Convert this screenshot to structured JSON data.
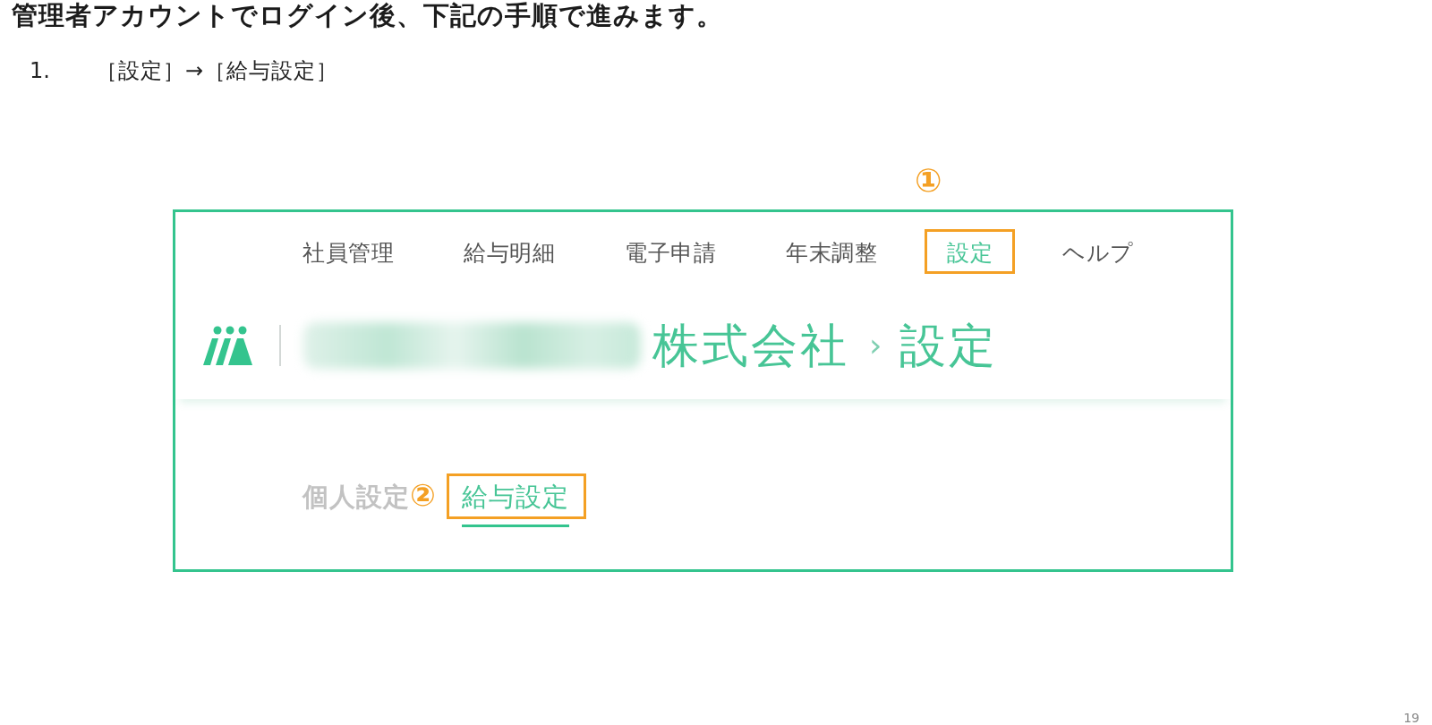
{
  "heading": "管理者アカウントでログイン後、下記の手順で進みます。",
  "steps": [
    {
      "number": "1.",
      "text": "［設定］→［給与設定］"
    }
  ],
  "screenshot": {
    "nav": [
      {
        "label": "社員管理",
        "selected": false,
        "highlighted": false
      },
      {
        "label": "給与明細",
        "selected": false,
        "highlighted": false
      },
      {
        "label": "電子申請",
        "selected": false,
        "highlighted": false
      },
      {
        "label": "年末調整",
        "selected": false,
        "highlighted": false
      },
      {
        "label": "設定",
        "selected": true,
        "highlighted": true,
        "callout": "①"
      },
      {
        "label": "ヘルプ",
        "selected": false,
        "highlighted": false
      }
    ],
    "breadcrumb": {
      "company": "株式会社",
      "separator": "›",
      "current": "設定"
    },
    "tabs": [
      {
        "label": "個人設定",
        "selected": false,
        "highlighted": false
      },
      {
        "label": "給与設定",
        "selected": true,
        "highlighted": true,
        "callout": "②"
      }
    ]
  },
  "page_number": "19"
}
